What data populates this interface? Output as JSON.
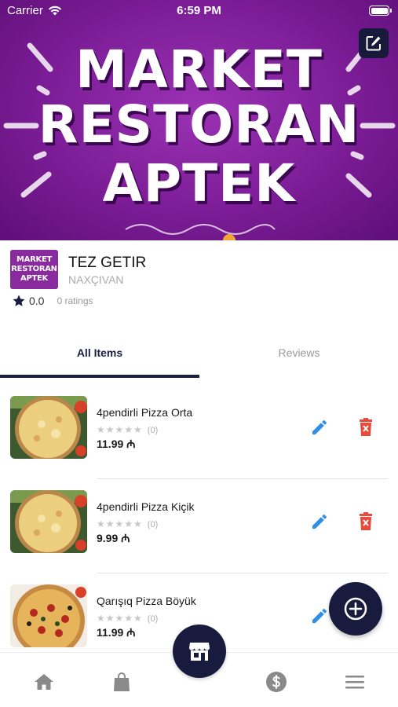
{
  "status_bar": {
    "carrier": "Carrier",
    "time": "6:59 PM"
  },
  "banner": {
    "lines": [
      "MARKET",
      "RESTORAN",
      "APTEK"
    ],
    "background_color": "#7c1d97"
  },
  "store": {
    "logo_lines": [
      "MARKET",
      "RESTORAN",
      "APTEK"
    ],
    "name": "TEZ GETIR",
    "city": "NAXÇIVAN",
    "rating": "0.0",
    "ratings_count": "0 ratings"
  },
  "tabs": [
    {
      "label": "All Items",
      "active": true
    },
    {
      "label": "Reviews",
      "active": false
    }
  ],
  "items": [
    {
      "name": "4pendirli Pizza Orta",
      "stars": "★★★★★",
      "rating_count": "(0)",
      "price": "11.99 ₼",
      "image": "cheese-pizza"
    },
    {
      "name": "4pendirli Pizza Kiçik",
      "stars": "★★★★★",
      "rating_count": "(0)",
      "price": "9.99 ₼",
      "image": "cheese-pizza"
    },
    {
      "name": "Qarışıq Pizza Böyük",
      "stars": "★★★★★",
      "rating_count": "(0)",
      "price": "11.99 ₼",
      "image": "mixed-pizza"
    }
  ],
  "colors": {
    "navy": "#181b3d",
    "edit_blue": "#2f8fe0",
    "delete_red": "#e84b3c",
    "banner_purple": "#7c1d97"
  },
  "bottom_nav": {
    "icons": [
      "home-icon",
      "shopping-bag-icon",
      "store-icon",
      "dollar-icon",
      "menu-icon"
    ]
  }
}
